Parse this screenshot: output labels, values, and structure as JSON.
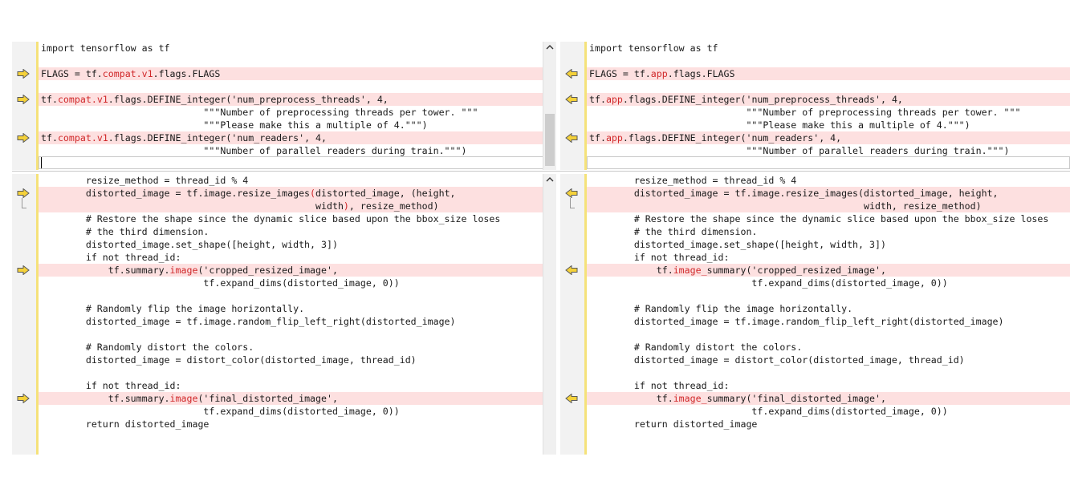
{
  "left": {
    "top": [
      {
        "text": "import tensorflow as tf"
      },
      {
        "text": ""
      },
      {
        "text": "FLAGS = tf.compat.v1.flags.FLAGS",
        "hl": [
          "compat.v1"
        ],
        "diff": true
      },
      {
        "text": ""
      },
      {
        "text": "tf.compat.v1.flags.DEFINE_integer('num_preprocess_threads', 4,",
        "hl": [
          "compat.v1"
        ],
        "diff": true
      },
      {
        "text": "                             \"\"\"Number of preprocessing threads per tower. \"\"\""
      },
      {
        "text": "                             \"\"\"Please make this a multiple of 4.\"\"\")"
      },
      {
        "text": "tf.compat.v1.flags.DEFINE_integer('num_readers', 4,",
        "hl": [
          "compat.v1"
        ],
        "diff": true
      },
      {
        "text": "                             \"\"\"Number of parallel readers during train.\"\"\")"
      }
    ],
    "bottom": [
      {
        "text": "        resize_method = thread_id % 4"
      },
      {
        "text": "        distorted_image = tf.image.resize_images(distorted_image, (height,",
        "hl": [
          "("
        ],
        "diff": true
      },
      {
        "text": "                                                 width), resize_method)",
        "hl": [
          ")"
        ],
        "diff": true
      },
      {
        "text": "        # Restore the shape since the dynamic slice based upon the bbox_size loses"
      },
      {
        "text": "        # the third dimension."
      },
      {
        "text": "        distorted_image.set_shape([height, width, 3])"
      },
      {
        "text": "        if not thread_id:"
      },
      {
        "text": "            tf.summary.image('cropped_resized_image',",
        "hl": [
          "image"
        ],
        "diff": true
      },
      {
        "text": "                             tf.expand_dims(distorted_image, 0))"
      },
      {
        "text": ""
      },
      {
        "text": "        # Randomly flip the image horizontally."
      },
      {
        "text": "        distorted_image = tf.image.random_flip_left_right(distorted_image)"
      },
      {
        "text": ""
      },
      {
        "text": "        # Randomly distort the colors."
      },
      {
        "text": "        distorted_image = distort_color(distorted_image, thread_id)"
      },
      {
        "text": ""
      },
      {
        "text": "        if not thread_id:"
      },
      {
        "text": "            tf.summary.image('final_distorted_image',",
        "hl": [
          "image"
        ],
        "diff": true
      },
      {
        "text": "                             tf.expand_dims(distorted_image, 0))"
      },
      {
        "text": "        return distorted_image"
      }
    ]
  },
  "right": {
    "top": [
      {
        "text": "import tensorflow as tf"
      },
      {
        "text": ""
      },
      {
        "text": "FLAGS = tf.app.flags.FLAGS",
        "hl": [
          "app"
        ],
        "diff": true
      },
      {
        "text": ""
      },
      {
        "text": "tf.app.flags.DEFINE_integer('num_preprocess_threads', 4,",
        "hl": [
          "app"
        ],
        "diff": true
      },
      {
        "text": "                            \"\"\"Number of preprocessing threads per tower. \"\"\""
      },
      {
        "text": "                            \"\"\"Please make this a multiple of 4.\"\"\")"
      },
      {
        "text": "tf.app.flags.DEFINE_integer('num_readers', 4,",
        "hl": [
          "app"
        ],
        "diff": true
      },
      {
        "text": "                            \"\"\"Number of parallel readers during train.\"\"\")"
      }
    ],
    "bottom": [
      {
        "text": "        resize_method = thread_id % 4"
      },
      {
        "text": "        distorted_image = tf.image.resize_images(distorted_image, height,",
        "diff": true
      },
      {
        "text": "                                                 width, resize_method)",
        "diff": true
      },
      {
        "text": "        # Restore the shape since the dynamic slice based upon the bbox_size loses"
      },
      {
        "text": "        # the third dimension."
      },
      {
        "text": "        distorted_image.set_shape([height, width, 3])"
      },
      {
        "text": "        if not thread_id:"
      },
      {
        "text": "            tf.image_summary('cropped_resized_image',",
        "hl": [
          "image_"
        ],
        "diff": true
      },
      {
        "text": "                             tf.expand_dims(distorted_image, 0))"
      },
      {
        "text": ""
      },
      {
        "text": "        # Randomly flip the image horizontally."
      },
      {
        "text": "        distorted_image = tf.image.random_flip_left_right(distorted_image)"
      },
      {
        "text": ""
      },
      {
        "text": "        # Randomly distort the colors."
      },
      {
        "text": "        distorted_image = distort_color(distorted_image, thread_id)"
      },
      {
        "text": ""
      },
      {
        "text": "        if not thread_id:"
      },
      {
        "text": "            tf.image_summary('final_distorted_image',",
        "hl": [
          "image_"
        ],
        "diff": true
      },
      {
        "text": "                             tf.expand_dims(distorted_image, 0))"
      },
      {
        "text": "        return distorted_image"
      }
    ]
  },
  "icons": {
    "left_arrow": "arrow-right-icon",
    "right_arrow": "arrow-left-icon",
    "scroll_up": "chevron-up-icon"
  },
  "colors": {
    "diff_bg": "#fde0e0",
    "highlight_text": "#d0282a",
    "arrow_fill": "#f4d13a",
    "gutter_bar": "#f5e27a"
  }
}
